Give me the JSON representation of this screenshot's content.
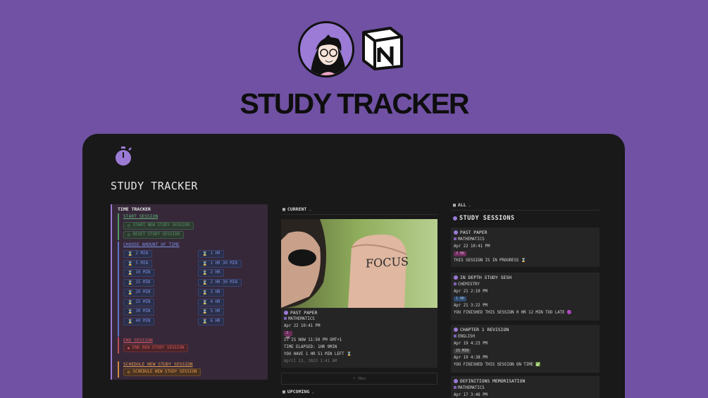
{
  "hero": {
    "title": "STUDY TRACKER"
  },
  "page": {
    "title": "STUDY TRACKER"
  },
  "tracker": {
    "title": "TIME TRACKER",
    "start": {
      "heading": "START SESSION",
      "buttons": [
        "START NEW STUDY SESSION",
        "RESET STUDY SESSION"
      ]
    },
    "choose": {
      "heading": "CHOOSE AMOUNT OF TIME",
      "left": [
        "2 MIN",
        "5 MIN",
        "10 MIN",
        "15 MIN",
        "20 MIN",
        "25 MIN",
        "30 MIN",
        "40 MIN"
      ],
      "right": [
        "1 HR",
        "1 HR 30 MIN",
        "2 HR",
        "2 HR 30 MIN",
        "3 HR",
        "4 HR",
        "5 HR",
        "6 HR"
      ]
    },
    "end": {
      "heading": "END SESSION",
      "button": "END NEW STUDY SESSION"
    },
    "schedule": {
      "heading": "SCHEDULE NEW STUDY SESSION",
      "button": "SCHEDULE NEW STUDY SESSION"
    }
  },
  "current": {
    "view_label": "CURRENT",
    "photo_text": "FOCUS",
    "card": {
      "title": "PAST PAPER",
      "subject": "MATHEMATICS",
      "date": "Apr 22 10:41 PM",
      "tag": "3 HR",
      "now": "IT IS NOW 11:50 PM GMT+1",
      "elapsed": "TIME ELAPSED: 1HR 9MIN",
      "left": "YOU HAVE 1 HR 51 MIN LEFT ⌛",
      "created": "April 23, 2023 1:41 AM"
    },
    "new_label": "+ New"
  },
  "upcoming": {
    "view_label": "UPCOMING"
  },
  "sessions": {
    "view_label": "ALL",
    "title": "STUDY SESSIONS",
    "cards": [
      {
        "title": "PAST PAPER",
        "subject": "MATHEMATICS",
        "date1": "Apr 22 10:41 PM",
        "tag": "3 HR",
        "tag_color": "#6b2d5a",
        "tag_text": "#e9a3d6",
        "date2": "",
        "status": "THIS SESSION IS IN PROGRESS ⌛"
      },
      {
        "title": "IN DEPTH STUDY SESH",
        "subject": "CHEMISTRY",
        "date1": "Apr 21 2:10 PM",
        "tag": "1 HR",
        "tag_color": "#2d4a6b",
        "tag_text": "#9fc3ea",
        "date2": "Apr 21 3:22 PM",
        "status": "YOU FINISHED THIS SESSION 0 HR 12 MIN TOO LATE 🟣"
      },
      {
        "title": "CHAPTER 1 REVISION",
        "subject": "ENGLISH",
        "date1": "Apr 19 4:23 PM",
        "tag": "15 MIN",
        "tag_color": "#444444",
        "tag_text": "#cfcfcf",
        "date2": "Apr 19 4:38 PM",
        "status": "YOU FINISHED THIS SESSION ON TIME ✅"
      },
      {
        "title": "DEFINITIONS MEMORISATION",
        "subject": "MATHEMATICS",
        "date1": "Apr 17 3:46 PM",
        "tag": "",
        "tag_color": "",
        "tag_text": "",
        "date2": "",
        "status": ""
      }
    ]
  }
}
